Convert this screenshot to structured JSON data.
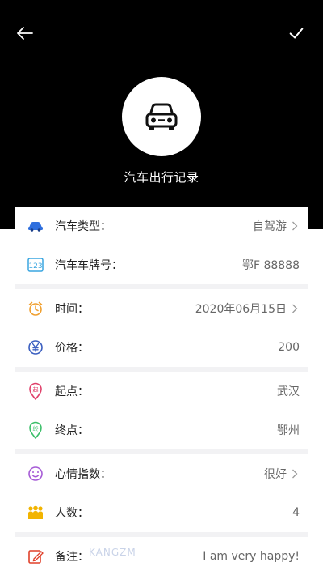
{
  "header": {
    "title": "汽车出行记录",
    "colors": {
      "background": "#000000",
      "title": "#ffffff"
    }
  },
  "nav": {
    "back_icon": "arrow-left-icon",
    "done_icon": "checkmark-icon"
  },
  "hero": {
    "icon": "car-icon"
  },
  "groups": [
    {
      "rows": [
        {
          "label": "汽车类型：",
          "value": "自驾游",
          "icon": "car-type-icon",
          "icon_color": "#2f6fde",
          "chevron": true
        },
        {
          "label": "汽车车牌号：",
          "value": "鄂F 88888",
          "icon": "license-plate-icon",
          "icon_color": "#3aa6e0",
          "chevron": false
        }
      ]
    },
    {
      "rows": [
        {
          "label": "时间：",
          "value": "2020年06月15日",
          "icon": "alarm-clock-icon",
          "icon_color": "#f0a030",
          "chevron": true
        },
        {
          "label": "价格：",
          "value": "200",
          "icon": "yen-icon",
          "icon_color": "#3b5fc0",
          "chevron": false
        }
      ]
    },
    {
      "rows": [
        {
          "label": "起点：",
          "value": "武汉",
          "icon": "start-pin-icon",
          "icon_color": "#e0406a",
          "chevron": false
        },
        {
          "label": "终点：",
          "value": "鄂州",
          "icon": "end-pin-icon",
          "icon_color": "#3cbf6a",
          "chevron": false
        }
      ]
    },
    {
      "rows": [
        {
          "label": "心情指数：",
          "value": "很好",
          "icon": "smiley-icon",
          "icon_color": "#a65bd6",
          "chevron": true
        },
        {
          "label": "人数：",
          "value": "4",
          "icon": "people-icon",
          "icon_color": "#f2b400",
          "chevron": false
        }
      ]
    },
    {
      "rows": [
        {
          "label": "备注：",
          "value": "I am very happy!",
          "icon": "note-edit-icon",
          "icon_color": "#e0402a",
          "chevron": false
        }
      ]
    }
  ],
  "watermark": "KANGZM"
}
